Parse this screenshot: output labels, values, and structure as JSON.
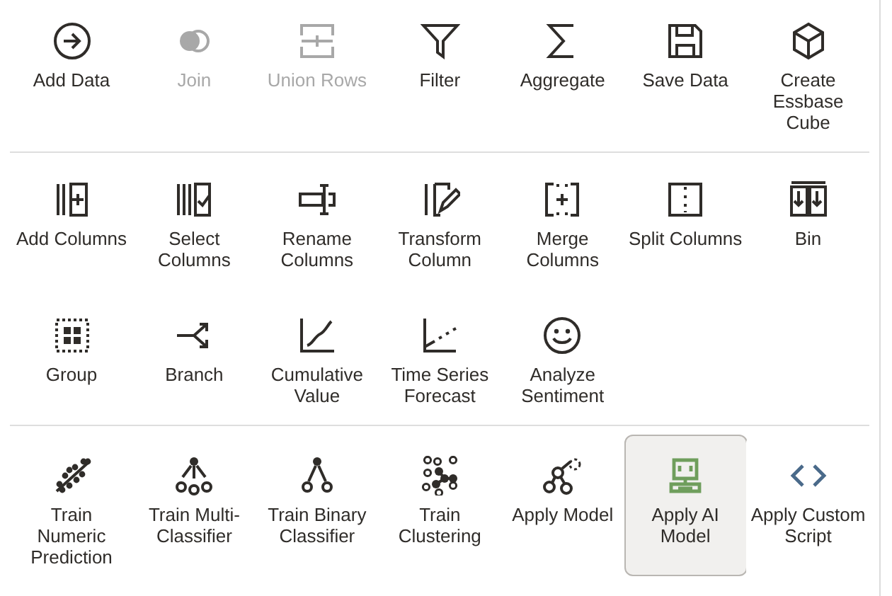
{
  "sections": [
    {
      "items": [
        {
          "label": "Add Data",
          "disabled": false,
          "selected": false
        },
        {
          "label": "Join",
          "disabled": true,
          "selected": false
        },
        {
          "label": "Union Rows",
          "disabled": true,
          "selected": false
        },
        {
          "label": "Filter",
          "disabled": false,
          "selected": false
        },
        {
          "label": "Aggregate",
          "disabled": false,
          "selected": false
        },
        {
          "label": "Save Data",
          "disabled": false,
          "selected": false
        },
        {
          "label": "Create Essbase Cube",
          "disabled": false,
          "selected": false
        }
      ]
    },
    {
      "items": [
        {
          "label": "Add Columns",
          "disabled": false,
          "selected": false
        },
        {
          "label": "Select Columns",
          "disabled": false,
          "selected": false
        },
        {
          "label": "Rename Columns",
          "disabled": false,
          "selected": false
        },
        {
          "label": "Transform Column",
          "disabled": false,
          "selected": false
        },
        {
          "label": "Merge Columns",
          "disabled": false,
          "selected": false
        },
        {
          "label": "Split Columns",
          "disabled": false,
          "selected": false
        },
        {
          "label": "Bin",
          "disabled": false,
          "selected": false
        },
        {
          "label": "Group",
          "disabled": false,
          "selected": false
        },
        {
          "label": "Branch",
          "disabled": false,
          "selected": false
        },
        {
          "label": "Cumulative Value",
          "disabled": false,
          "selected": false
        },
        {
          "label": "Time Series Forecast",
          "disabled": false,
          "selected": false
        },
        {
          "label": "Analyze Sentiment",
          "disabled": false,
          "selected": false
        }
      ]
    },
    {
      "items": [
        {
          "label": "Train Numeric Prediction",
          "disabled": false,
          "selected": false
        },
        {
          "label": "Train Multi-Classifier",
          "disabled": false,
          "selected": false
        },
        {
          "label": "Train Binary Classifier",
          "disabled": false,
          "selected": false
        },
        {
          "label": "Train Clustering",
          "disabled": false,
          "selected": false
        },
        {
          "label": "Apply Model",
          "disabled": false,
          "selected": false
        },
        {
          "label": "Apply AI Model",
          "disabled": false,
          "selected": true
        },
        {
          "label": "Apply Custom Script",
          "disabled": false,
          "selected": false
        }
      ]
    }
  ]
}
